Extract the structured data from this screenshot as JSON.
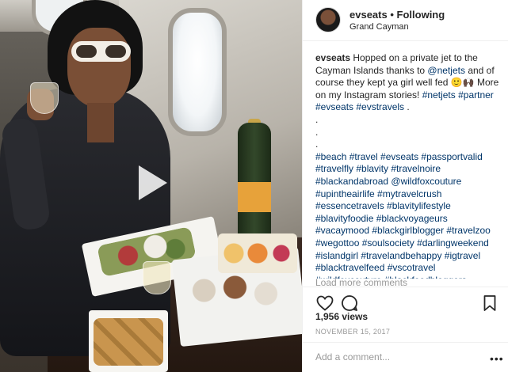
{
  "post": {
    "username": "evseats",
    "separator": "•",
    "follow_status": "Following",
    "location": "Grand Cayman"
  },
  "caption": {
    "username": "evseats",
    "text_part1": "Hopped on a private jet to the Cayman Islands thanks to",
    "mention_netjets": "@netjets",
    "text_part2": "and of course they kept ya girl well fed 🙂🙌🏿 More on my Instagram stories!",
    "tag_netjets": "#netjets",
    "tags_line1": "#partner #evseats #evstravels",
    "tags_line1_end": ".",
    "dot1": ".",
    "dot2": ".",
    "dot3": ".",
    "hashtags": "#beach #travel #evseats #passportvalid #travelfly #blavity #travelnoire #blackandabroad @wildfoxcouture #upintheairlife #mytravelcrush #essencetravels #blavitylifestyle #blavityfoodie #blackvoyageurs #vacaymood #blackgirlblogger #travelzoo #wegottoo #soulsociety #darlingweekend #islandgirl #travelandbehappy #igtravel #blacktravelfeed #vscotravel #wildfoxcouture #blackfoodbloggers"
  },
  "load_more": "Load more comments",
  "stats": {
    "views": "1,956 views",
    "date": "NOVEMBER 15, 2017"
  },
  "comment": {
    "placeholder": "Add a comment...",
    "more": "•••"
  },
  "icons": {
    "like": "heart-icon",
    "comment": "comment-icon",
    "save": "bookmark-icon",
    "play": "play-icon"
  }
}
